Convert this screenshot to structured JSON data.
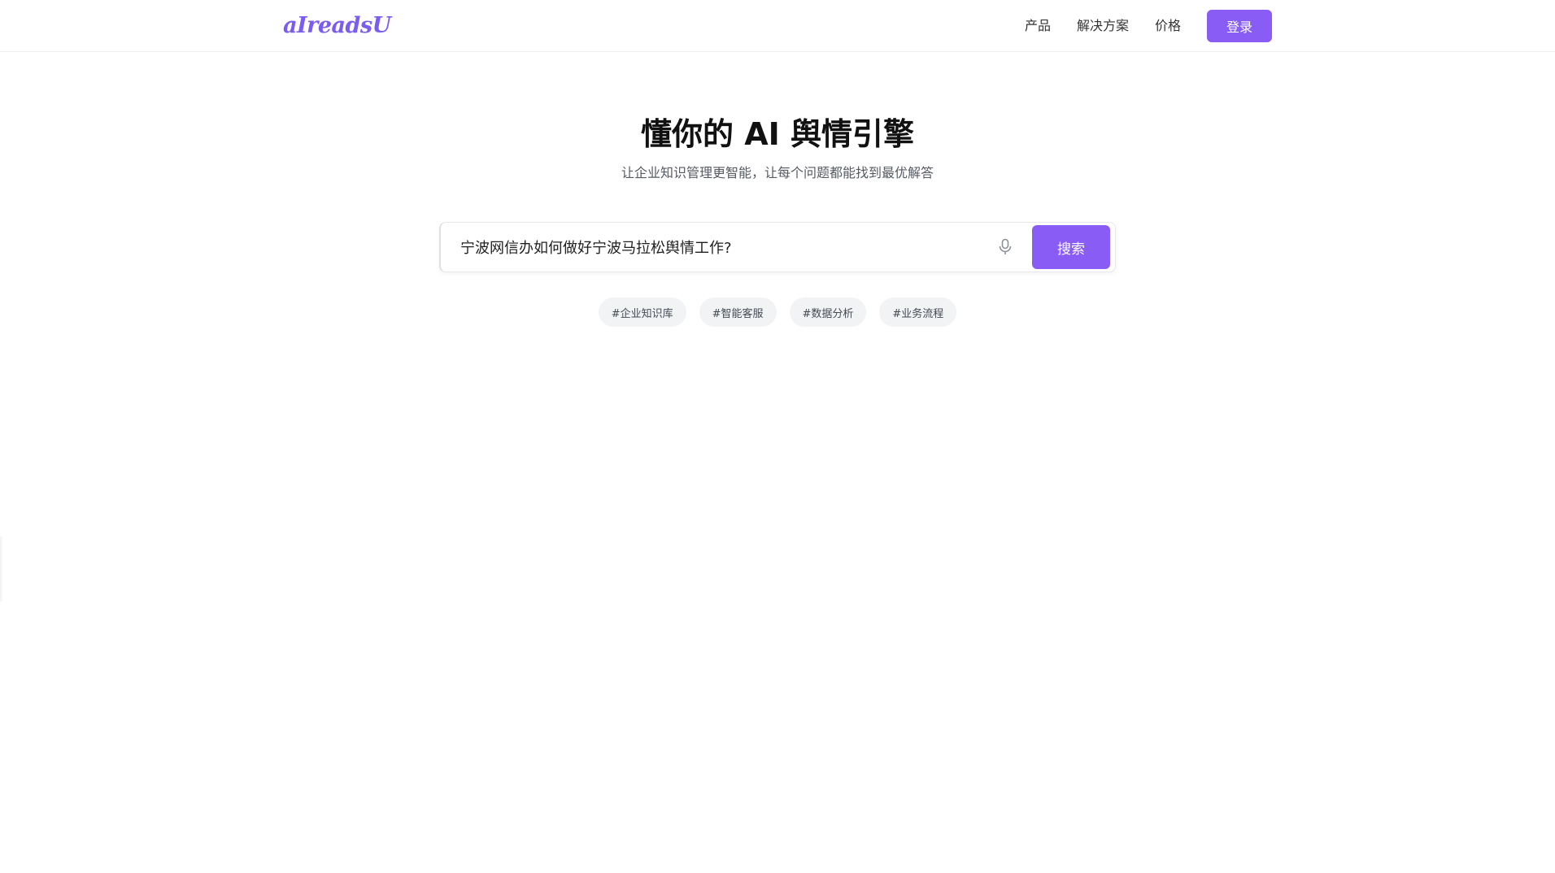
{
  "header": {
    "logo": "aIreadsU",
    "nav": [
      {
        "label": "产品"
      },
      {
        "label": "解决方案"
      },
      {
        "label": "价格"
      }
    ],
    "login_label": "登录"
  },
  "hero": {
    "title": "懂你的 AI 舆情引擎",
    "subtitle": "让企业知识管理更智能，让每个问题都能找到最优解答"
  },
  "search": {
    "value": "宁波网信办如何做好宁波马拉松舆情工作?",
    "button_label": "搜索",
    "mic_icon": "microphone-icon"
  },
  "tags": [
    {
      "label": "#企业知识库"
    },
    {
      "label": "#智能客服"
    },
    {
      "label": "#数据分析"
    },
    {
      "label": "#业务流程"
    }
  ],
  "colors": {
    "accent": "#8a5cf6",
    "logo": "#7b5cf0",
    "tag_bg": "#f2f3f5"
  }
}
